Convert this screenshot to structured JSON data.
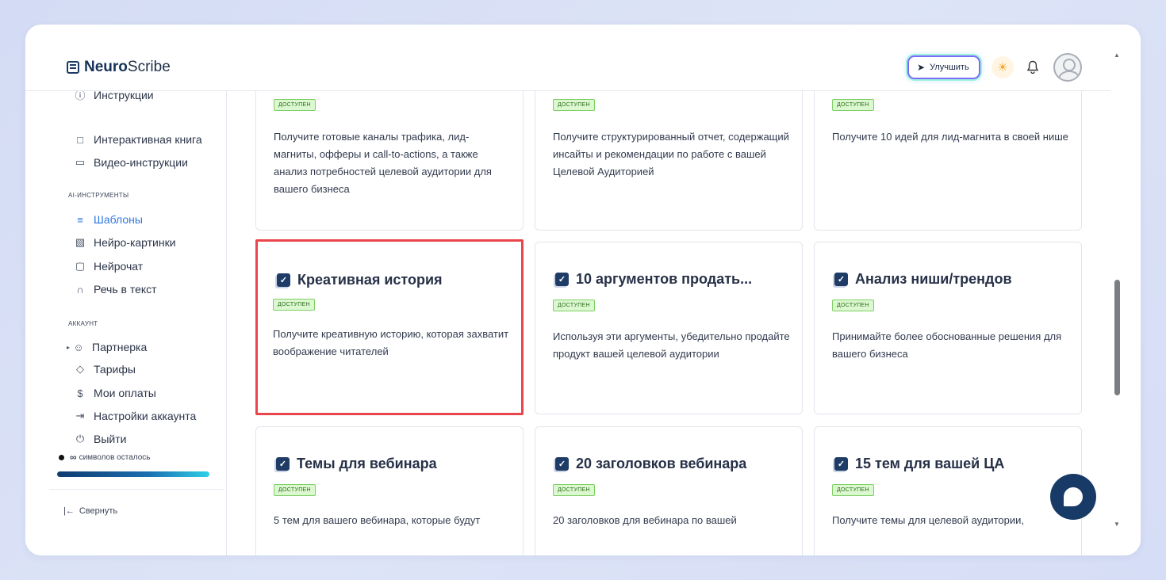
{
  "app": {
    "logo_bold": "Neuro",
    "logo_light": "Scribe",
    "upgrade_label": "Улучшить"
  },
  "sidebar": {
    "items_top": [
      {
        "label": "Инструкции",
        "icon": "info-icon"
      },
      {
        "label": "Интерактивная книга",
        "icon": "book-icon"
      },
      {
        "label": "Видео-инструкции",
        "icon": "video-icon"
      }
    ],
    "ai_section_label": "AI-ИНСТРУМЕНТЫ",
    "ai_items": [
      {
        "label": "Шаблоны",
        "icon": "layers-icon",
        "active": true
      },
      {
        "label": "Нейро-картинки",
        "icon": "image-icon"
      },
      {
        "label": "Нейрочат",
        "icon": "chat-icon"
      },
      {
        "label": "Речь в текст",
        "icon": "headphones-icon"
      }
    ],
    "account_section_label": "АККАУНТ",
    "account_items": [
      {
        "label": "Партнерка",
        "icon": "users-icon"
      },
      {
        "label": "Тарифы",
        "icon": "tag-icon"
      },
      {
        "label": "Мои оплаты",
        "icon": "dollar-icon"
      },
      {
        "label": "Настройки аккаунта",
        "icon": "login-icon"
      },
      {
        "label": "Выйти",
        "icon": "power-icon"
      }
    ],
    "symbols_infinity": "∞",
    "symbols_text": "символов осталось",
    "collapse_label": "Свернуть"
  },
  "cards": {
    "row1": [
      {
        "badge": "доступен",
        "desc": "Получите готовые каналы трафика, лид-магниты, офферы и call-to-actions, а также анализ потребностей целевой аудитории для вашего бизнеса"
      },
      {
        "badge": "доступен",
        "desc": "Получите структурированный отчет, содержащий инсайты и рекомендации по работе с вашей Целевой Аудиторией"
      },
      {
        "badge": "доступен",
        "desc": "Получите 10 идей для лид-магнита в своей нише"
      }
    ],
    "row2": [
      {
        "title": "Креативная история",
        "badge": "доступен",
        "desc": "Получите креативную историю, которая захватит воображение читателей"
      },
      {
        "title": "10 аргументов продать...",
        "badge": "доступен",
        "desc": "Используя эти аргументы, убедительно продайте продукт вашей целевой аудитории"
      },
      {
        "title": "Анализ ниши/трендов",
        "badge": "доступен",
        "desc": "Принимайте более обоснованные решения для вашего бизнеса"
      }
    ],
    "row3": [
      {
        "title": "Темы для вебинара",
        "badge": "доступен",
        "desc": "5 тем для вашего вебинара, которые будут"
      },
      {
        "title": "20 заголовков вебинара",
        "badge": "доступен",
        "desc": "20 заголовков для вебинара по вашей"
      },
      {
        "title": "15 тем для вашей ЦА",
        "badge": "доступен",
        "desc": "Получите темы для целевой аудитории,"
      }
    ]
  },
  "colors": {
    "accent": "#2f78e0",
    "highlight": "#e8454c",
    "badge_bg": "#dcf8d0",
    "brand_dark": "#1f3c66"
  }
}
